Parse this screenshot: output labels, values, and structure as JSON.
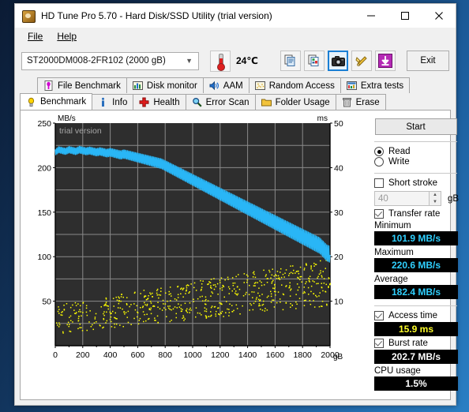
{
  "window": {
    "title": "HD Tune Pro 5.70 - Hard Disk/SSD Utility (trial version)",
    "app_icon": "harddisk-icon",
    "minimize": "–",
    "maximize": "☐",
    "close": "✕"
  },
  "menu": {
    "items": [
      {
        "label": "File",
        "mnemonic": "F"
      },
      {
        "label": "Help",
        "mnemonic": "H"
      }
    ]
  },
  "toolbar": {
    "drive_selected": "ST2000DM008-2FR102 (2000 gB)",
    "drive_caret": "chevron-down-icon",
    "temperature": "24℃",
    "buttons": [
      {
        "name": "copy-text-button",
        "icon": "copy-document-icon"
      },
      {
        "name": "copy-image-button",
        "icon": "copy-image-icon"
      },
      {
        "name": "screenshot-button",
        "icon": "camera-icon",
        "active": true
      },
      {
        "name": "wrench-button",
        "icon": "tools-icon"
      },
      {
        "name": "save-button",
        "icon": "download-arrow-icon"
      }
    ],
    "exit_label": "Exit"
  },
  "tabs": {
    "row1": [
      {
        "label": "File Benchmark",
        "icon": "file-benchmark-icon",
        "selected": false
      },
      {
        "label": "Disk monitor",
        "icon": "bar-chart-icon",
        "selected": false
      },
      {
        "label": "AAM",
        "icon": "speaker-icon",
        "selected": false
      },
      {
        "label": "Random Access",
        "icon": "scatter-icon",
        "selected": false
      },
      {
        "label": "Extra tests",
        "icon": "extra-tests-icon",
        "selected": false
      }
    ],
    "row2": [
      {
        "label": "Benchmark",
        "icon": "lightbulb-icon",
        "selected": true
      },
      {
        "label": "Info",
        "icon": "info-icon",
        "selected": false
      },
      {
        "label": "Health",
        "icon": "red-cross-icon",
        "selected": false
      },
      {
        "label": "Error Scan",
        "icon": "magnifier-icon",
        "selected": false
      },
      {
        "label": "Folder Usage",
        "icon": "folder-icon",
        "selected": false
      },
      {
        "label": "Erase",
        "icon": "trash-icon",
        "selected": false
      }
    ]
  },
  "side_panel": {
    "start_label": "Start",
    "mode_read": "Read",
    "mode_write": "Write",
    "mode_selected": "Read",
    "short_stroke_label": "Short stroke",
    "short_stroke_checked": false,
    "short_stroke_value": "40",
    "short_stroke_unit": "gB",
    "transfer_rate_label": "Transfer rate",
    "transfer_rate_checked": true,
    "minimum_label": "Minimum",
    "minimum_value": "101.9 MB/s",
    "maximum_label": "Maximum",
    "maximum_value": "220.6 MB/s",
    "average_label": "Average",
    "average_value": "182.4 MB/s",
    "access_time_label": "Access time",
    "access_time_checked": true,
    "access_time_value": "15.9 ms",
    "burst_rate_label": "Burst rate",
    "burst_rate_checked": true,
    "burst_rate_value": "202.7 MB/s",
    "cpu_usage_label": "CPU usage",
    "cpu_usage_value": "1.5%"
  },
  "colors": {
    "transfer_line": "#29b6f6",
    "access_dots": "#ffff00",
    "plot_bg": "#2e2e2e",
    "grid": "#8a8a8a",
    "value_cyan": "#2fd0ff",
    "value_yellow": "#ffff2a",
    "accent_blue": "#1a7fd4"
  },
  "chart_data": {
    "type": "line",
    "title": "",
    "watermark": "trial version",
    "ylabel": "MB/s",
    "ylabel_right": "ms",
    "xlabel": "gB",
    "xlim": [
      0,
      2000
    ],
    "ylim": [
      0,
      250
    ],
    "ylim_right": [
      0,
      50
    ],
    "grid": true,
    "xticks": [
      0,
      200,
      400,
      600,
      800,
      1000,
      1200,
      1400,
      1600,
      1800,
      2000
    ],
    "yticks_left": [
      50,
      100,
      150,
      200,
      250
    ],
    "yticks_right": [
      10,
      20,
      30,
      40,
      50
    ],
    "series": [
      {
        "name": "Transfer rate",
        "type": "line",
        "color": "#29b6f6",
        "axis": "left",
        "unit": "MB/s",
        "x": [
          0,
          25,
          50,
          75,
          100,
          125,
          150,
          175,
          200,
          225,
          250,
          275,
          300,
          325,
          350,
          375,
          400,
          425,
          450,
          475,
          500,
          525,
          550,
          575,
          600,
          625,
          650,
          675,
          700,
          725,
          750,
          775,
          800,
          825,
          850,
          875,
          900,
          925,
          950,
          975,
          1000,
          1025,
          1050,
          1075,
          1100,
          1125,
          1150,
          1175,
          1200,
          1225,
          1250,
          1275,
          1300,
          1325,
          1350,
          1375,
          1400,
          1425,
          1450,
          1475,
          1500,
          1525,
          1550,
          1575,
          1600,
          1625,
          1650,
          1675,
          1700,
          1725,
          1750,
          1775,
          1800,
          1825,
          1850,
          1875,
          1900,
          1925,
          1950,
          1975,
          2000
        ],
        "y": [
          217,
          220,
          219,
          218,
          220,
          219,
          218,
          220,
          219,
          218,
          219,
          218,
          217,
          218,
          217,
          216,
          217,
          216,
          215,
          214,
          215,
          214,
          213,
          212,
          211,
          210,
          209,
          208,
          207,
          206,
          205,
          204,
          202,
          200,
          198,
          196,
          194,
          192,
          190,
          188,
          186,
          184,
          182,
          180,
          178,
          176,
          174,
          172,
          170,
          168,
          166,
          164,
          162,
          160,
          158,
          156,
          154,
          152,
          150,
          148,
          146,
          144,
          142,
          140,
          138,
          136,
          134,
          132,
          130,
          128,
          126,
          124,
          122,
          120,
          118,
          116,
          114,
          112,
          108,
          104,
          102
        ]
      },
      {
        "name": "Access time",
        "type": "scatter",
        "color": "#ffff00",
        "axis": "right",
        "unit": "ms",
        "average": 15.9,
        "range_ms": [
          5,
          20
        ],
        "description": "scattered yellow dots rising from ~6 ms near 0 gB to ~18 ms near 2000 gB"
      }
    ]
  }
}
